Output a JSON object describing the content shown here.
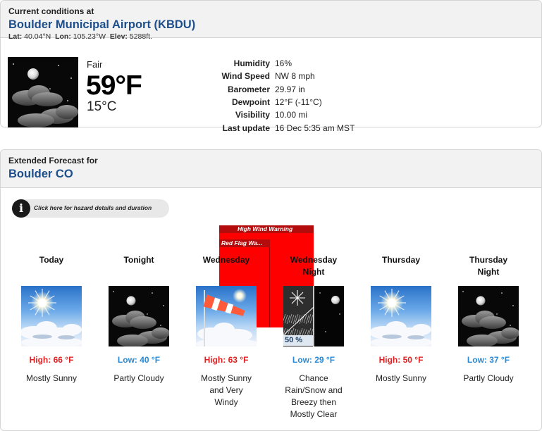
{
  "current": {
    "heading": "Current conditions at",
    "station": "Boulder Municipal Airport (KBDU)",
    "lat_label": "Lat:",
    "lat": "40.04°N",
    "lon_label": "Lon:",
    "lon": "105.23°W",
    "elev_label": "Elev:",
    "elev": "5288ft.",
    "condition": "Fair",
    "temp_f": "59°F",
    "temp_c": "15°C",
    "icon": "night-moon-clouds-icon",
    "details": [
      {
        "label": "Humidity",
        "value": "16%"
      },
      {
        "label": "Wind Speed",
        "value": "NW 8 mph"
      },
      {
        "label": "Barometer",
        "value": "29.97 in"
      },
      {
        "label": "Dewpoint",
        "value": "12°F (-11°C)"
      },
      {
        "label": "Visibility",
        "value": "10.00 mi"
      },
      {
        "label": "Last update",
        "value": "16 Dec 5:35 am MST"
      }
    ]
  },
  "forecast": {
    "heading": "Extended Forecast for",
    "location": "Boulder CO",
    "hazard_button": "Click here for hazard details and duration",
    "warnings": [
      {
        "label": "High Wind Warning",
        "color": "#ff0000"
      },
      {
        "label": "Red Flag Wa...",
        "color": "#ff0000"
      }
    ],
    "periods": [
      {
        "name_line1": "Today",
        "name_line2": "",
        "temp": "High: 66 °F",
        "kind": "high",
        "desc": [
          "Mostly Sunny"
        ],
        "icon": "sunny-icon"
      },
      {
        "name_line1": "Tonight",
        "name_line2": "",
        "temp": "Low: 40 °F",
        "kind": "low",
        "desc": [
          "Partly Cloudy"
        ],
        "icon": "night-moon-clouds-icon"
      },
      {
        "name_line1": "Wednesday",
        "name_line2": "",
        "temp": "High: 63 °F",
        "kind": "high",
        "desc": [
          "Mostly Sunny",
          "and Very",
          "Windy"
        ],
        "icon": "windsock-icon"
      },
      {
        "name_line1": "Wednesday",
        "name_line2": "Night",
        "temp": "Low: 29 °F",
        "kind": "low",
        "desc": [
          "Chance",
          "Rain/Snow and",
          "Breezy then",
          "Mostly Clear"
        ],
        "icon": "rain-snow-night-icon",
        "pop": "50 %"
      },
      {
        "name_line1": "Thursday",
        "name_line2": "",
        "temp": "High: 50 °F",
        "kind": "high",
        "desc": [
          "Mostly Sunny"
        ],
        "icon": "sunny-icon"
      },
      {
        "name_line1": "Thursday",
        "name_line2": "Night",
        "temp": "Low: 37 °F",
        "kind": "low",
        "desc": [
          "Partly Cloudy"
        ],
        "icon": "night-moon-clouds-icon"
      }
    ]
  },
  "colors": {
    "high": "#e22020",
    "low": "#2a8ad6",
    "title_blue": "#1c4f8c",
    "warning_red": "#ff0000"
  }
}
